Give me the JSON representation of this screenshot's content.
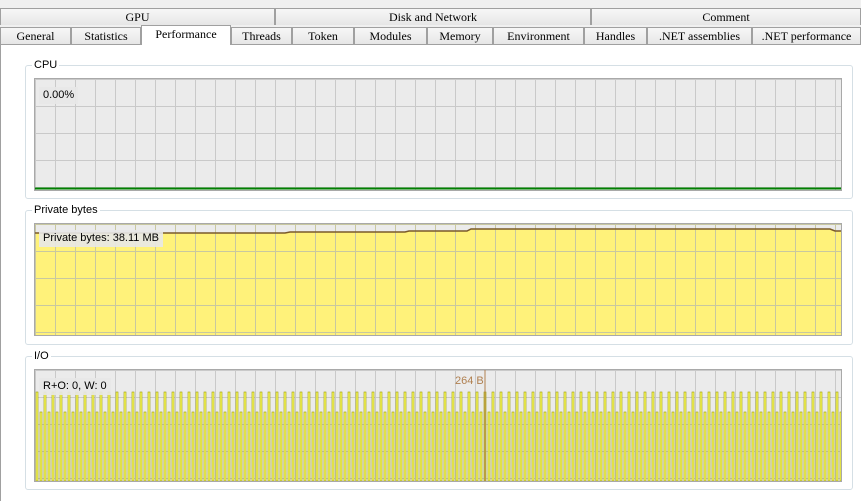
{
  "tabs_row1": [
    "GPU",
    "Disk and Network",
    "Comment"
  ],
  "tabs_row2": [
    "General",
    "Statistics",
    "Performance",
    "Threads",
    "Token",
    "Modules",
    "Memory",
    "Environment",
    "Handles",
    ".NET assemblies",
    ".NET performance"
  ],
  "active_tab": "Performance",
  "cpu": {
    "title": "CPU",
    "value_label": "0.00%",
    "line_color": "#008000",
    "bg_color": "#ebebeb"
  },
  "private_bytes": {
    "title": "Private bytes",
    "value_label": "Private bytes: 38.11 MB",
    "fill_color": "#fff27a",
    "line_color": "#7a5a2a"
  },
  "io": {
    "title": "I/O",
    "value_label": "R+O: 0, W: 0",
    "peak_label": "264 B",
    "bar_color": "#ffff66",
    "bar_stroke": "#9b9b00"
  }
}
